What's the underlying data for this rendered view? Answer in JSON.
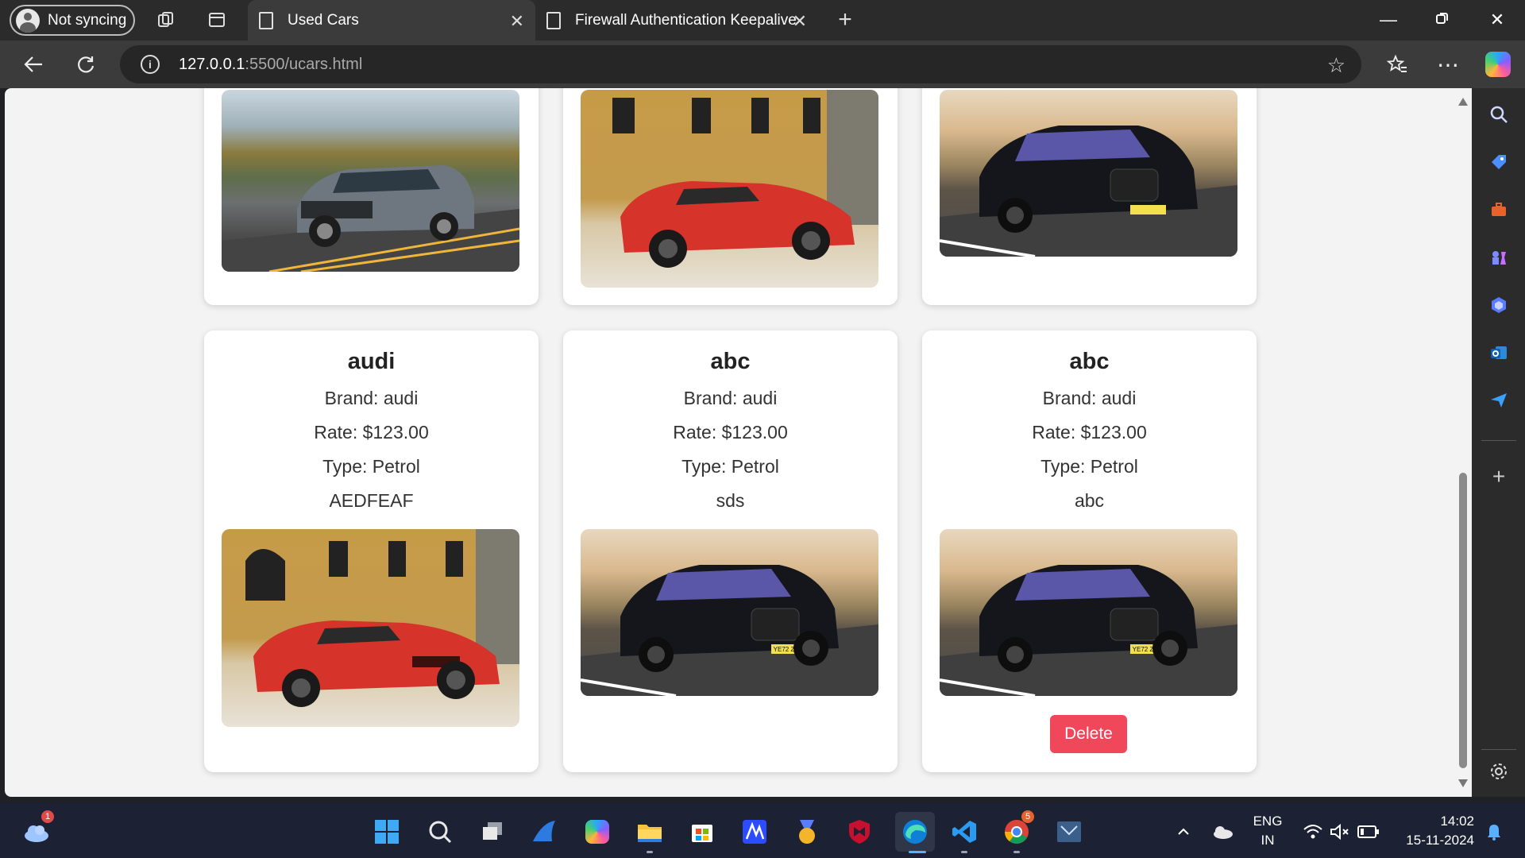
{
  "browser": {
    "profile_label": "Not syncing",
    "tabs": [
      {
        "label": "Used Cars",
        "active": true
      },
      {
        "label": "Firewall Authentication Keepalive",
        "active": false
      }
    ],
    "address": {
      "host": "127.0.0.1",
      "path": ":5500/ucars.html"
    }
  },
  "cards": [
    {
      "image": "ford-explorer-suv"
    },
    {
      "image": "red-ferrari-convertible"
    },
    {
      "image": "black-bmw-sedan"
    },
    {
      "title": "audi",
      "brand": "Brand: audi",
      "rate": "Rate: $123.00",
      "type": "Type: Petrol",
      "description": "AEDFEAF",
      "image": "red-ferrari-convertible"
    },
    {
      "title": "abc",
      "brand": "Brand: audi",
      "rate": "Rate: $123.00",
      "type": "Type: Petrol",
      "description": "sds",
      "image": "black-bmw-sedan"
    },
    {
      "title": "abc",
      "brand": "Brand: audi",
      "rate": "Rate: $123.00",
      "type": "Type: Petrol",
      "description": "abc",
      "image": "black-bmw-sedan",
      "delete_label": "Delete"
    }
  ],
  "plates": {
    "bmw": "YE72 ZRG"
  },
  "colors": {
    "delete": "#f0475a",
    "accent": "#0078d4"
  },
  "taskbar": {
    "weather_badge": "1",
    "chrome_badge": "5",
    "language": {
      "line1": "ENG",
      "line2": "IN"
    },
    "time": "14:02",
    "date": "15-11-2024"
  }
}
